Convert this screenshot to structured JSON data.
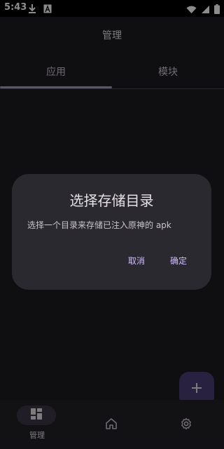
{
  "status_bar": {
    "time": "5:43",
    "left_icons": [
      "download-icon",
      "font-icon"
    ],
    "right_icons": [
      "wifi-icon",
      "signal-icon",
      "battery-icon"
    ]
  },
  "top_bar": {
    "title": "管理"
  },
  "tabs": [
    {
      "label": "应用",
      "selected": true
    },
    {
      "label": "模块",
      "selected": false
    }
  ],
  "fab": {
    "icon": "plus-icon"
  },
  "bottom_nav": [
    {
      "label": "管理",
      "icon": "dashboard-icon",
      "selected": true
    },
    {
      "label": "",
      "icon": "home-icon",
      "selected": false
    },
    {
      "label": "",
      "icon": "settings-icon",
      "selected": false
    }
  ],
  "dialog": {
    "title": "选择存储目录",
    "message": "选择一个目录来存储已注入原神的 apk",
    "cancel_label": "取消",
    "confirm_label": "确定"
  },
  "colors": {
    "accent": "#cfbcff",
    "indicator": "#a69ccd",
    "fab_bg": "#4a3f75",
    "dialog_bg": "#2b2930"
  }
}
